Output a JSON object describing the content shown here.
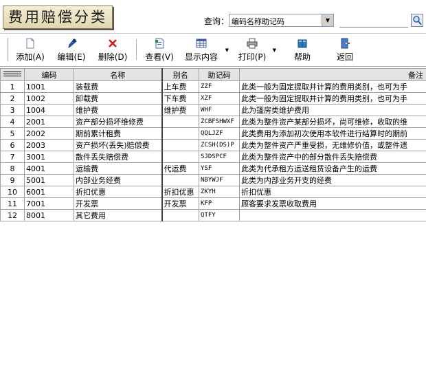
{
  "header": {
    "title": "费用赔偿分类",
    "query_label": "查询：",
    "query_selected": "编码名称助记码",
    "query_value": ""
  },
  "toolbar": {
    "buttons": [
      {
        "label": "添加(A)",
        "icon": "new-document-icon"
      },
      {
        "label": "编辑(E)",
        "icon": "edit-pen-icon"
      },
      {
        "label": "删除(D)",
        "icon": "delete-x-icon"
      },
      {
        "label": "查看(V)",
        "icon": "view-document-icon"
      },
      {
        "label": "显示内容",
        "icon": "display-grid-icon"
      },
      {
        "label": "打印(P)",
        "icon": "printer-icon"
      },
      {
        "label": "帮助",
        "icon": "help-book-icon"
      },
      {
        "label": "返回",
        "icon": "exit-door-icon"
      }
    ]
  },
  "grid": {
    "columns": [
      "编码",
      "名称",
      "别名",
      "助记码",
      "备注"
    ],
    "rows": [
      [
        "1",
        "1001",
        "装载费",
        "上车费",
        "ZZF",
        "此类一般为固定提取并计算的费用类别，也可为手"
      ],
      [
        "2",
        "1002",
        "卸载费",
        "下车费",
        "XZF",
        "此类一般为固定提取并计算的费用类别，也可为手"
      ],
      [
        "3",
        "1004",
        "维护费",
        "维护费",
        "WHF",
        "此为篷房类维护费用"
      ],
      [
        "4",
        "2001",
        "资产部分损坏维修费",
        "",
        "ZCBFSHWXF",
        "此类为整件资产某部分损坏，尚可维修，收取的维"
      ],
      [
        "5",
        "2002",
        "期前累计租费",
        "",
        "QQLJZF",
        "此类费用为添加初次使用本软件进行结算时的期前"
      ],
      [
        "6",
        "2003",
        "资产损坏(丢失)赔偿费",
        "",
        "ZCSH(DS)P",
        "此类为整件资产严重受损，无维修价值，或整件遗"
      ],
      [
        "7",
        "3001",
        "散件丢失赔偿费",
        "",
        "SJDSPCF",
        "此类为整件资产中的部分散件丢失赔偿费"
      ],
      [
        "8",
        "4001",
        "运输费",
        "代运费",
        "YSF",
        "此类为代承租方运送租赁设备产生的运费"
      ],
      [
        "9",
        "5001",
        "内部业务经费",
        "",
        "NBYWJF",
        "此类为内部业务开支的经费"
      ],
      [
        "10",
        "6001",
        "折扣优惠",
        "折扣优惠",
        "ZKYH",
        "折扣优惠"
      ],
      [
        "11",
        "7001",
        "开发票",
        "开发票",
        "KFP",
        "顾客要求发票收取费用"
      ],
      [
        "12",
        "8001",
        "其它费用",
        "",
        "QTFY",
        ""
      ]
    ]
  }
}
